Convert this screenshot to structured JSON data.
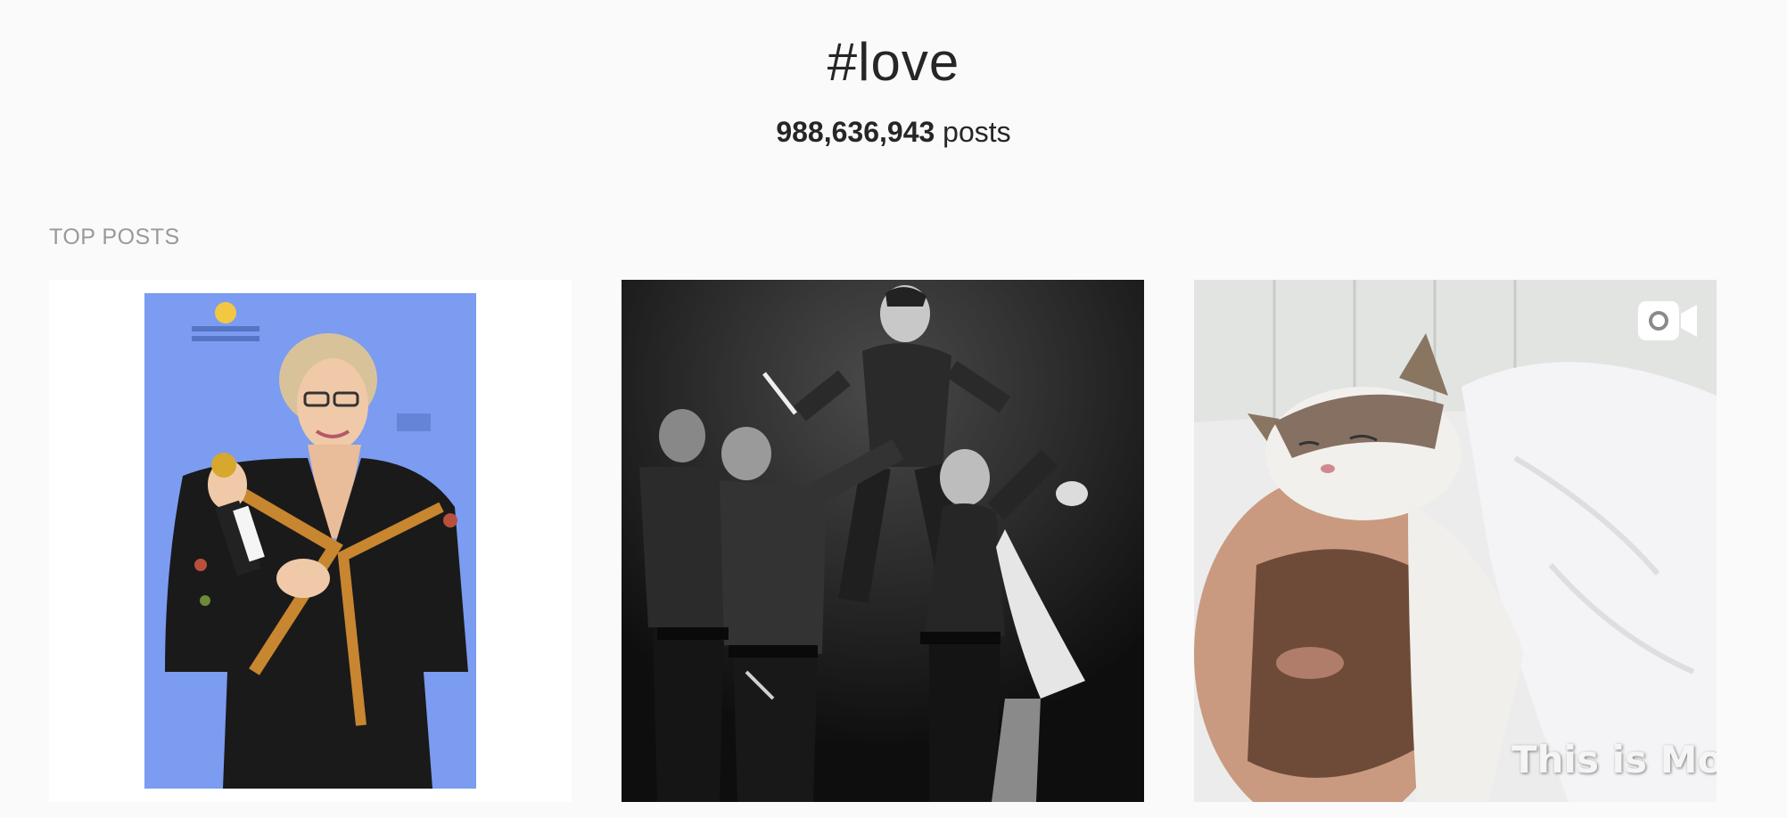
{
  "header": {
    "hashtag": "#love",
    "post_count": "988,636,943",
    "post_count_suffix": " posts"
  },
  "sections": {
    "top_posts_label": "TOP POSTS"
  },
  "posts": [
    {
      "image": "award winner holding trophy in front of blue backdrop"
    },
    {
      "image": "black and white photo of stage performers in leather costumes"
    },
    {
      "image": "cat sleeping on bearded man's face",
      "media_type": "video",
      "overlay_text": "This is Mo"
    }
  ],
  "icons": {
    "video_badge": "video-camera-icon"
  },
  "colors": {
    "background": "#fafafa",
    "text": "#262626",
    "section_label": "#999999",
    "photo1_backdrop": "#7b9cf0"
  }
}
